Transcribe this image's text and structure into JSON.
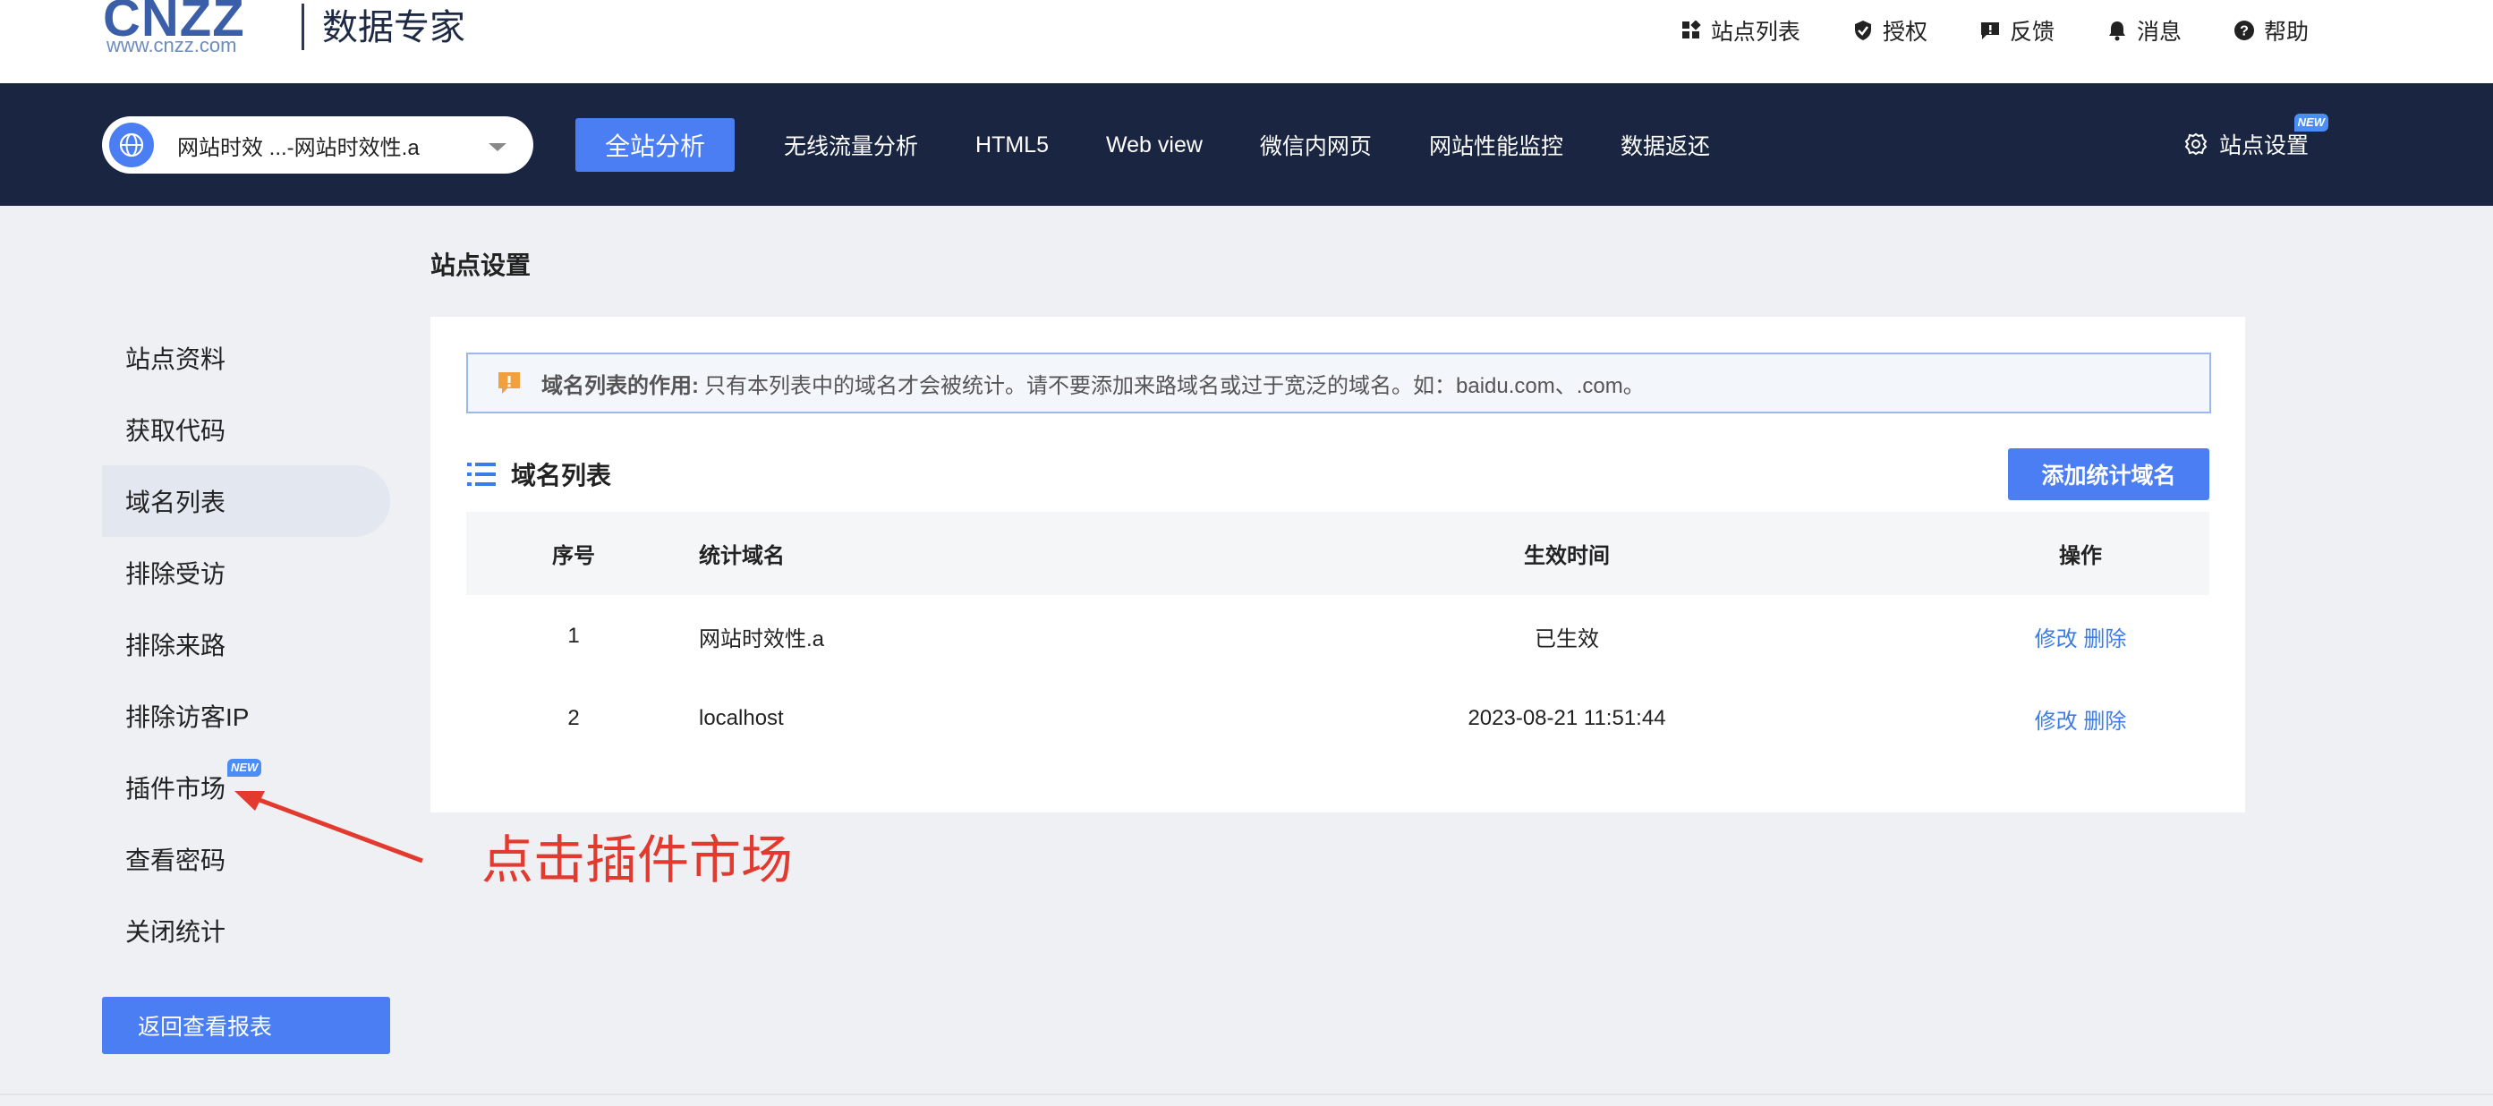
{
  "header": {
    "logo_word": "CNZZ",
    "logo_url": "www.cnzz.com",
    "product": "数据专家",
    "links": [
      {
        "label": "站点列表",
        "icon": "grid-icon"
      },
      {
        "label": "授权",
        "icon": "shield-check-icon"
      },
      {
        "label": "反馈",
        "icon": "feedback-icon"
      },
      {
        "label": "消息",
        "icon": "bell-icon"
      },
      {
        "label": "帮助",
        "icon": "help-icon"
      }
    ]
  },
  "nav": {
    "site_select": "网站时效 ...-网站时效性.a",
    "items": [
      "全站分析",
      "无线流量分析",
      "HTML5",
      "Web view",
      "微信内网页",
      "网站性能监控",
      "数据返还"
    ],
    "active_item": "全站分析",
    "settings_label": "站点设置",
    "settings_badge": "NEW"
  },
  "sidebar": {
    "items": [
      {
        "label": "站点资料"
      },
      {
        "label": "获取代码"
      },
      {
        "label": "域名列表",
        "active": true
      },
      {
        "label": "排除受访"
      },
      {
        "label": "排除来路"
      },
      {
        "label": "排除访客IP"
      },
      {
        "label": "插件市场",
        "badge": "NEW"
      },
      {
        "label": "查看密码"
      },
      {
        "label": "关闭统计"
      }
    ],
    "back_button": "返回查看报表"
  },
  "main": {
    "page_title": "站点设置",
    "notice_title": "域名列表的作用:",
    "notice_text": "只有本列表中的域名才会被统计。请不要添加来路域名或过于宽泛的域名。如：baidu.com、.com。",
    "list_title": "域名列表",
    "add_button": "添加统计域名",
    "table": {
      "headers": [
        "序号",
        "统计域名",
        "生效时间",
        "操作"
      ],
      "rows": [
        {
          "index": "1",
          "domain": "网站时效性.a",
          "time": "已生效",
          "edit": "修改",
          "delete": "删除"
        },
        {
          "index": "2",
          "domain": "localhost",
          "time": "2023-08-21 11:51:44",
          "edit": "修改",
          "delete": "删除"
        }
      ]
    }
  },
  "annotation": {
    "text": "点击插件市场"
  },
  "colors": {
    "accent": "#4a7ef2",
    "navbar": "#1a2541",
    "annotation": "#e23a2e",
    "link": "#3c7ce9"
  }
}
